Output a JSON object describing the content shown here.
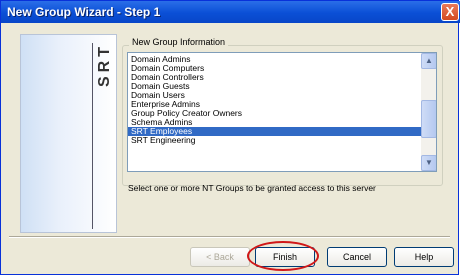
{
  "window": {
    "title": "New Group Wizard - Step 1",
    "close_glyph": "X"
  },
  "side_panel": {
    "brand_text": "SRT"
  },
  "group_box": {
    "label": "New Group Information",
    "list_items": [
      {
        "label": "Domain Admins",
        "selected": false
      },
      {
        "label": "Domain Computers",
        "selected": false
      },
      {
        "label": "Domain Controllers",
        "selected": false
      },
      {
        "label": "Domain Guests",
        "selected": false
      },
      {
        "label": "Domain Users",
        "selected": false
      },
      {
        "label": "Enterprise Admins",
        "selected": false
      },
      {
        "label": "Group Policy Creator Owners",
        "selected": false
      },
      {
        "label": "Schema Admins",
        "selected": false
      },
      {
        "label": "SRT Employees",
        "selected": true
      },
      {
        "label": "SRT Engineering",
        "selected": false
      }
    ]
  },
  "instruction": "Select one or more NT Groups to be granted access to this server",
  "buttons": {
    "back": "< Back",
    "finish": "Finish",
    "cancel": "Cancel",
    "help": "Help"
  },
  "colors": {
    "selection": "#316ac5",
    "annotation_ring": "#d01818",
    "titlebar": "#0a4fd6"
  }
}
